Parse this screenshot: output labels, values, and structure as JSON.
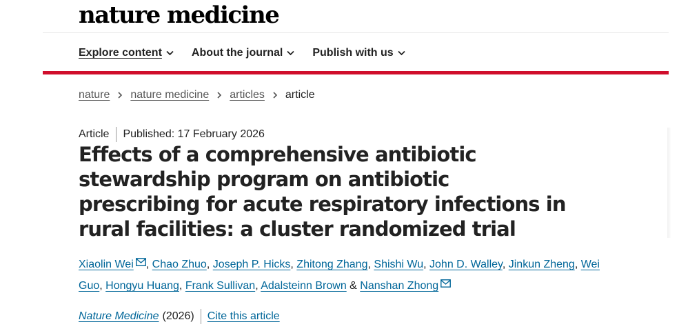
{
  "header": {
    "brand": "nature medicine",
    "nav": [
      {
        "label": "Explore content",
        "icon": "chevron-down-icon"
      },
      {
        "label": "About the journal",
        "icon": "chevron-down-icon"
      },
      {
        "label": "Publish with us",
        "icon": "chevron-down-icon"
      }
    ],
    "accent_color": "#d00e2c"
  },
  "breadcrumb": [
    "nature",
    "nature medicine",
    "articles",
    "article"
  ],
  "meta": {
    "type": "Article",
    "published": "Published: 17 February 2026"
  },
  "title": "Effects of a comprehensive antibiotic stewardship program on antibiotic prescribing for acute respiratory infections in rural facilities: a cluster randomized trial",
  "authors": [
    "Xiaolin Wei",
    "Chao Zhuo",
    "Joseph P. Hicks",
    "Zhitong Zhang",
    "Shishi Wu",
    "John D. Walley",
    "Jinkun Zheng",
    "Wei Guo",
    "Hongyu Huang",
    "Frank Sullivan",
    "Adalsteinn Brown",
    "Nanshan Zhong"
  ],
  "author_separators": {
    "comma": ",",
    "ampersand": "&"
  },
  "journal": {
    "name": "Nature Medicine",
    "year": "(2026)",
    "cite_label": "Cite this article"
  },
  "link_color": "#006699"
}
